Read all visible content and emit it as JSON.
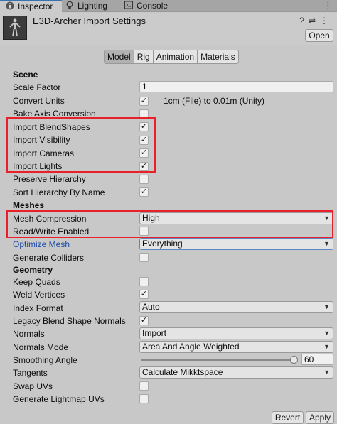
{
  "tabs": [
    {
      "label": "Inspector",
      "icon": "info-icon",
      "active": true
    },
    {
      "label": "Lighting",
      "icon": "bulb-icon",
      "active": false
    },
    {
      "label": "Console",
      "icon": "console-icon",
      "active": false
    }
  ],
  "header": {
    "title": "E3D-Archer Import Settings",
    "open_label": "Open",
    "icons": [
      "help-icon",
      "settings-icon",
      "more-icon"
    ]
  },
  "subtabs": [
    "Model",
    "Rig",
    "Animation",
    "Materials"
  ],
  "sections": {
    "scene": "Scene",
    "meshes": "Meshes",
    "geometry": "Geometry"
  },
  "fields": {
    "scale_factor": {
      "label": "Scale Factor",
      "value": "1"
    },
    "convert_units": {
      "label": "Convert Units",
      "checked": true,
      "note": "1cm (File) to 0.01m (Unity)"
    },
    "bake_axis": {
      "label": "Bake Axis Conversion",
      "checked": false
    },
    "import_blendshapes": {
      "label": "Import BlendShapes",
      "checked": true
    },
    "import_visibility": {
      "label": "Import Visibility",
      "checked": true
    },
    "import_cameras": {
      "label": "Import Cameras",
      "checked": true
    },
    "import_lights": {
      "label": "Import Lights",
      "checked": true
    },
    "preserve_hierarchy": {
      "label": "Preserve Hierarchy",
      "checked": false
    },
    "sort_hierarchy": {
      "label": "Sort Hierarchy By Name",
      "checked": true
    },
    "mesh_compression": {
      "label": "Mesh Compression",
      "value": "High"
    },
    "read_write": {
      "label": "Read/Write Enabled",
      "checked": false
    },
    "optimize_mesh": {
      "label": "Optimize Mesh",
      "value": "Everything"
    },
    "generate_colliders": {
      "label": "Generate Colliders",
      "checked": false
    },
    "keep_quads": {
      "label": "Keep Quads",
      "checked": false
    },
    "weld_vertices": {
      "label": "Weld Vertices",
      "checked": true
    },
    "index_format": {
      "label": "Index Format",
      "value": "Auto"
    },
    "legacy_blend": {
      "label": "Legacy Blend Shape Normals",
      "checked": true
    },
    "normals": {
      "label": "Normals",
      "value": "Import"
    },
    "normals_mode": {
      "label": "Normals Mode",
      "value": "Area And Angle Weighted"
    },
    "smoothing_angle": {
      "label": "Smoothing Angle",
      "value": "60"
    },
    "tangents": {
      "label": "Tangents",
      "value": "Calculate Mikktspace"
    },
    "swap_uvs": {
      "label": "Swap UVs",
      "checked": false
    },
    "lightmap_uvs": {
      "label": "Generate Lightmap UVs",
      "checked": false
    }
  },
  "buttons": {
    "revert": "Revert",
    "apply": "Apply"
  },
  "check_glyph": "✓",
  "dropdown_arrow": "▼",
  "colors": {
    "highlight": "#e8202a",
    "active_tab_accent": "#3a72b0",
    "link_blue": "#1a4ba8"
  }
}
